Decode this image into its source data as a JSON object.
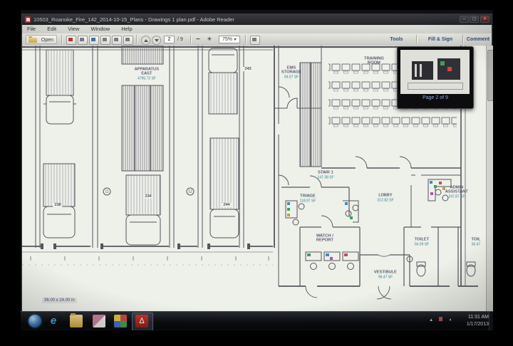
{
  "window": {
    "title": "10503_Roanoke_Fire_142_2014-10-15_Plans - Drawings 1 plan.pdf - Adobe Reader"
  },
  "menu": {
    "items": [
      "File",
      "Edit",
      "View",
      "Window",
      "Help"
    ]
  },
  "toolbar": {
    "open_label": "Open",
    "icons": [
      "save-icon",
      "create-pdf-icon",
      "sign-icon",
      "stamp-icon",
      "print-icon",
      "email-icon"
    ],
    "page_current": "2",
    "page_total": "/ 9",
    "zoom_out": "−",
    "zoom_in": "+",
    "zoom_level": "75%",
    "tools_label": "Tools",
    "fill_sign_label": "Fill & Sign",
    "comment_label": "Comment"
  },
  "popup": {
    "label": "Page 2 of 9"
  },
  "plan": {
    "labels": [
      {
        "name": "APPARATUS\nEAST",
        "area": "4795.72 SF"
      },
      {
        "name": "EMS\nSTORAGE",
        "area": "94.07 SF"
      },
      {
        "name": "TRAINING\nROOM",
        "area": ""
      },
      {
        "name": "STAIR 1",
        "area": "147.38 SF"
      },
      {
        "name": "TRIAGE",
        "area": "118.97 SF"
      },
      {
        "name": "LOBBY",
        "area": "312.82 SF"
      },
      {
        "name": "ADMIN\nASSISTANT",
        "area": "247.87 SF"
      },
      {
        "name": "WATCH /\nREPORT",
        "area": ""
      },
      {
        "name": "TOILET",
        "area": "56.09 SF"
      },
      {
        "name": "TOIL",
        "area": "56.47"
      },
      {
        "name": "VESTIBULE",
        "area": "96.47 SF"
      }
    ],
    "room_numbers": [
      "238",
      "234",
      "244",
      "243"
    ],
    "grid_bubbles": [
      "11",
      "12"
    ],
    "size_indicator": "36.00 x 24.00 in"
  },
  "taskbar": {
    "icons": [
      "start-orb",
      "internet-explorer",
      "windows-explorer",
      "media-app",
      "photo-app",
      "adobe-reader"
    ],
    "ie_glyph": "e",
    "adobe_glyph": "Δ",
    "clock_time": "11:31 AM",
    "clock_date": "1/17/2013"
  }
}
